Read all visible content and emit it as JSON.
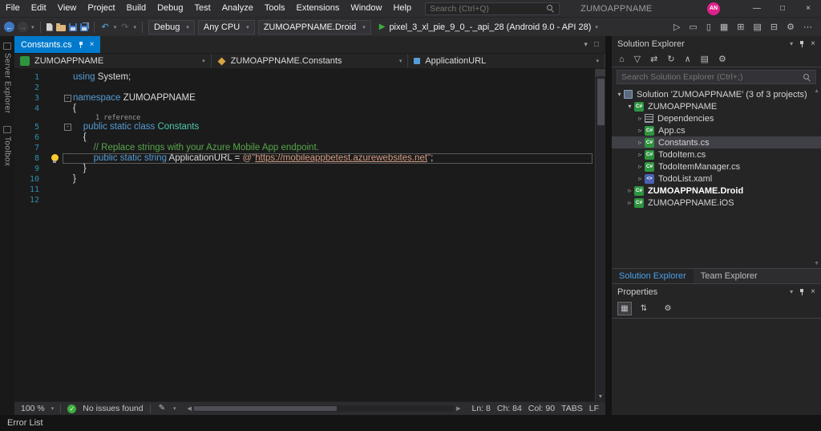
{
  "titlebar": {
    "menus": [
      "File",
      "Edit",
      "View",
      "Project",
      "Build",
      "Debug",
      "Test",
      "Analyze",
      "Tools",
      "Extensions",
      "Window",
      "Help"
    ],
    "search_placeholder": "Search (Ctrl+Q)",
    "window_title": "ZUMOAPPNAME",
    "avatar_initials": "AN",
    "window_buttons": {
      "minimize": "—",
      "maximize": "□",
      "close": "×"
    }
  },
  "toolbar": {
    "configuration": "Debug",
    "platform": "Any CPU",
    "startup_project": "ZUMOAPPNAME.Droid",
    "run_target": "pixel_3_xl_pie_9_0_-_api_28 (Android 9.0 - API 28)",
    "right_icons": [
      {
        "name": "profiler",
        "glyph": "▷"
      },
      {
        "name": "device-log",
        "glyph": "▭"
      },
      {
        "name": "android-device-manager",
        "glyph": "▯"
      },
      {
        "name": "android-sdk-manager",
        "glyph": "▦"
      },
      {
        "name": "nuget-package-manager",
        "glyph": "⊞"
      },
      {
        "name": "documents",
        "glyph": "▤"
      },
      {
        "name": "split-window",
        "glyph": "⊟"
      },
      {
        "name": "settings-gear",
        "glyph": "⚙"
      },
      {
        "name": "more-tools",
        "glyph": "⋯"
      }
    ]
  },
  "side_tabs": [
    {
      "label": "Server Explorer"
    },
    {
      "label": "Toolbox"
    }
  ],
  "editor": {
    "tab_label": "Constants.cs",
    "breadcrumbs": [
      {
        "label": "ZUMOAPPNAME",
        "icon": "project"
      },
      {
        "label": "ZUMOAPPNAME.Constants",
        "icon": "class"
      },
      {
        "label": "ApplicationURL",
        "icon": "field"
      }
    ],
    "lines": [
      {
        "no": 1,
        "segs": [
          [
            "k",
            "using"
          ],
          [
            "p",
            " System;"
          ]
        ]
      },
      {
        "no": 2,
        "segs": []
      },
      {
        "no": 3,
        "fold": true,
        "segs": [
          [
            "k",
            "namespace"
          ],
          [
            "p",
            " "
          ],
          [
            "p",
            "ZUMOAPPNAME"
          ]
        ]
      },
      {
        "no": 4,
        "segs": [
          [
            "p",
            "{"
          ]
        ]
      },
      {
        "no": 5,
        "fold": true,
        "codelens": "1 reference",
        "segs": [
          [
            "p",
            "    "
          ],
          [
            "k",
            "public static class"
          ],
          [
            "p",
            " "
          ],
          [
            "t",
            "Constants"
          ]
        ]
      },
      {
        "no": 6,
        "segs": [
          [
            "p",
            "    {"
          ]
        ]
      },
      {
        "no": 7,
        "segs": [
          [
            "p",
            "        "
          ],
          [
            "c",
            "// Replace strings with your Azure Mobile App endpoint."
          ]
        ]
      },
      {
        "no": 8,
        "current": true,
        "bulb": true,
        "segs": [
          [
            "p",
            "        "
          ],
          [
            "k",
            "public static string"
          ],
          [
            "p",
            " ApplicationURL = "
          ],
          [
            "s",
            "@\""
          ],
          [
            "sl",
            "https://mobileappbetest.azurewebsites.net"
          ],
          [
            "s",
            "\""
          ],
          [
            "p",
            ";"
          ]
        ]
      },
      {
        "no": 9,
        "segs": [
          [
            "p",
            "    }"
          ]
        ]
      },
      {
        "no": 10,
        "segs": [
          [
            "p",
            "}"
          ]
        ]
      },
      {
        "no": 11,
        "segs": []
      },
      {
        "no": 12,
        "segs": []
      }
    ]
  },
  "editor_status": {
    "zoom": "100 %",
    "health": "No issues found",
    "ln": "Ln: 8",
    "ch": "Ch: 84",
    "col": "Col: 90",
    "indent": "TABS",
    "eol": "LF"
  },
  "solution_explorer": {
    "title": "Solution Explorer",
    "search_placeholder": "Search Solution Explorer (Ctrl+;)",
    "toolbar_icons": [
      {
        "name": "home",
        "glyph": "⌂"
      },
      {
        "name": "filter",
        "glyph": "▽"
      },
      {
        "name": "sync-with-active-document",
        "glyph": "⇄"
      },
      {
        "name": "refresh",
        "glyph": "↻"
      },
      {
        "name": "collapse-all",
        "glyph": "∧"
      },
      {
        "name": "show-all-files",
        "glyph": "▤"
      },
      {
        "name": "properties",
        "glyph": "⚙"
      }
    ],
    "tree": [
      {
        "label": "Solution 'ZUMOAPPNAME' (3 of 3 projects)",
        "icon": "sol",
        "indent": 0,
        "state": "expanded"
      },
      {
        "label": "ZUMOAPPNAME",
        "icon": "cs",
        "indent": 1,
        "state": "expanded"
      },
      {
        "label": "Dependencies",
        "icon": "dep",
        "indent": 2,
        "state": "collapsed"
      },
      {
        "label": "App.cs",
        "icon": "cs",
        "indent": 2,
        "state": "collapsed"
      },
      {
        "label": "Constants.cs",
        "icon": "cs",
        "indent": 2,
        "state": "collapsed",
        "selected": true
      },
      {
        "label": "TodoItem.cs",
        "icon": "cs",
        "indent": 2,
        "state": "collapsed"
      },
      {
        "label": "TodoItemManager.cs",
        "icon": "cs",
        "indent": 2,
        "state": "collapsed"
      },
      {
        "label": "TodoList.xaml",
        "icon": "xaml",
        "indent": 2,
        "state": "collapsed"
      },
      {
        "label": "ZUMOAPPNAME.Droid",
        "icon": "cs",
        "indent": 1,
        "state": "collapsed",
        "bold": true
      },
      {
        "label": "ZUMOAPPNAME.iOS",
        "icon": "cs",
        "indent": 1,
        "state": "collapsed"
      }
    ],
    "tabs": [
      {
        "label": "Solution Explorer",
        "active": true
      },
      {
        "label": "Team Explorer",
        "active": false
      }
    ]
  },
  "properties": {
    "title": "Properties"
  },
  "error_list_label": "Error List",
  "colors": {
    "accent": "#007acc",
    "keyword": "#569cd6",
    "type": "#4ec9b0",
    "comment": "#57a64a",
    "string": "#d69d85",
    "line_number": "#2b91af",
    "run_green": "#3fae3f",
    "avatar_pink": "#e0218a",
    "editor_bg": "#1b1b1b",
    "panel_bg": "#252526",
    "chrome_bg": "#2d2d30"
  }
}
